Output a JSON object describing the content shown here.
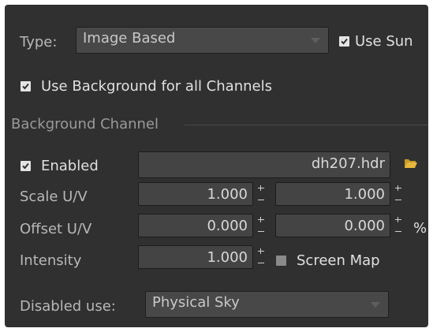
{
  "type_row": {
    "label": "Type:",
    "value": "Image Based",
    "use_sun_label": "Use Sun",
    "use_sun_checked": true
  },
  "use_background_all": {
    "label": "Use Background for all Channels",
    "checked": true
  },
  "section": {
    "title": "Background Channel"
  },
  "enabled": {
    "label": "Enabled",
    "checked": true,
    "file": "dh207.hdr"
  },
  "scale": {
    "label": "Scale U/V",
    "u": "1.000",
    "v": "1.000"
  },
  "offset": {
    "label": "Offset U/V",
    "u": "0.000",
    "v": "0.000",
    "unit": "%"
  },
  "intensity": {
    "label": "Intensity",
    "value": "1.000",
    "screen_map_label": "Screen Map",
    "screen_map_checked": false
  },
  "disabled_use": {
    "label": "Disabled use:",
    "value": "Physical Sky"
  },
  "icons": {
    "folder": "folder-icon",
    "combo_arrow": "chevron-down-icon",
    "spinner": "spinner-icon"
  }
}
